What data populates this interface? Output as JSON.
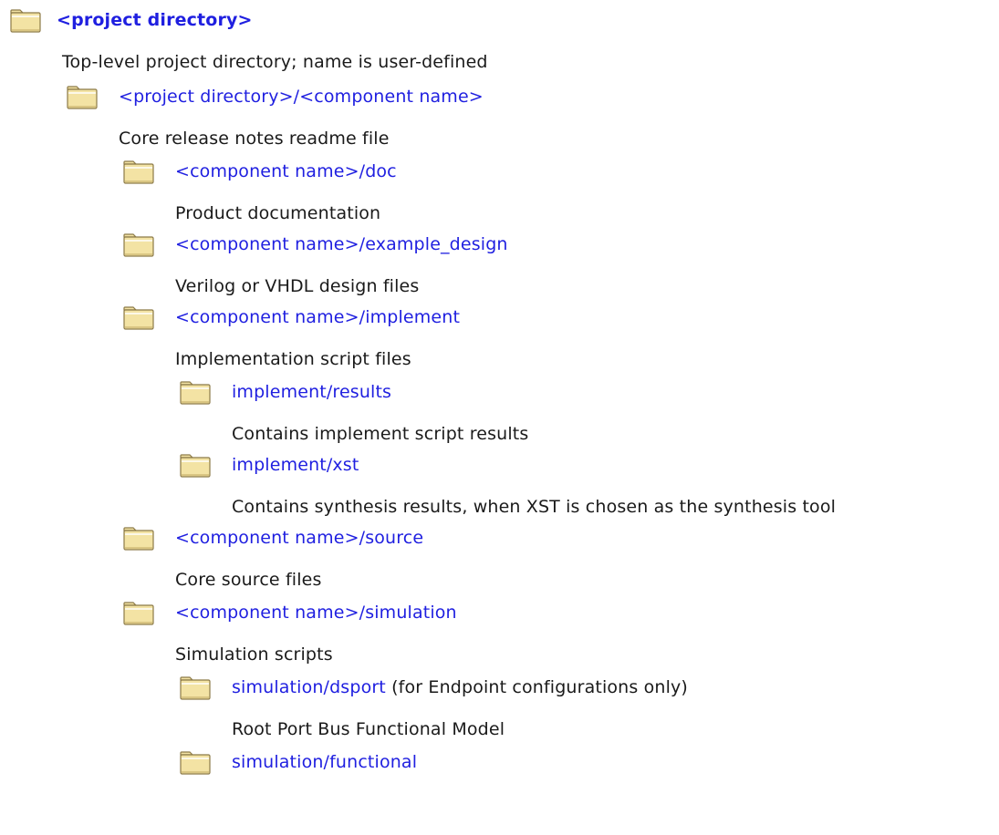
{
  "tree": {
    "root": {
      "path": "<project directory>",
      "description": "Top-level project directory; name is user-defined"
    },
    "component": {
      "path": "<project directory>/<component name>",
      "description": "Core release notes readme file"
    },
    "doc": {
      "path": "<component name>/doc",
      "description": "Product documentation"
    },
    "example_design": {
      "path": "<component name>/example_design",
      "description": "Verilog or VHDL design files"
    },
    "implement": {
      "path": "<component name>/implement",
      "description": "Implementation script files"
    },
    "implement_results": {
      "path": "implement/results",
      "description": "Contains implement script results"
    },
    "implement_xst": {
      "path": "implement/xst",
      "description": "Contains synthesis results, when XST is chosen as the synthesis tool"
    },
    "source": {
      "path": "<component name>/source",
      "description": "Core source files"
    },
    "simulation": {
      "path": "<component name>/simulation",
      "description": "Simulation scripts"
    },
    "simulation_dsport": {
      "path": "simulation/dsport",
      "note": " (for Endpoint configurations only)",
      "description": "Root Port Bus Functional Model"
    },
    "simulation_functional": {
      "path": "simulation/functional"
    }
  },
  "colors": {
    "link": "#1f1fe0",
    "text": "#1a1a1a",
    "folder_fill": "#f3e3a4",
    "folder_stroke": "#8c7a48"
  },
  "icons": {
    "folder": "folder-icon"
  }
}
